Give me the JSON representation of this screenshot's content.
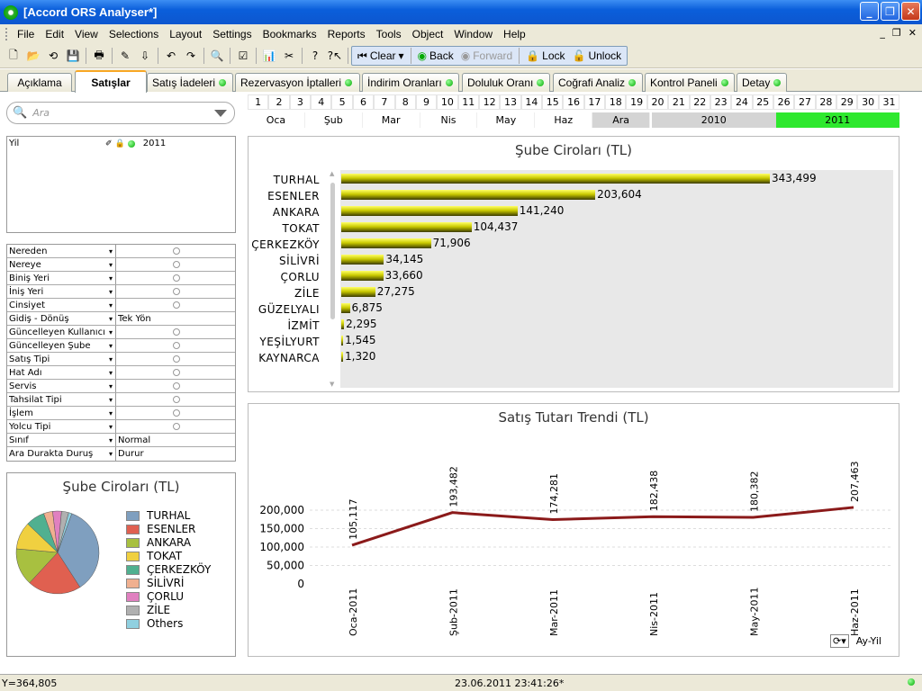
{
  "window": {
    "title": "[Accord ORS Analyser*]"
  },
  "menu": [
    "File",
    "Edit",
    "View",
    "Selections",
    "Layout",
    "Settings",
    "Bookmarks",
    "Reports",
    "Tools",
    "Object",
    "Window",
    "Help"
  ],
  "toolbar": {
    "clear": "Clear",
    "back": "Back",
    "forward": "Forward",
    "lock": "Lock",
    "unlock": "Unlock"
  },
  "tabs": [
    "Açıklama",
    "Satışlar",
    "Satış İadeleri",
    "Rezervasyon İptalleri",
    "İndirim Oranları",
    "Doluluk Oranı",
    "Coğrafi Analiz",
    "Kontrol Paneli",
    "Detay"
  ],
  "active_tab": "Satışlar",
  "search": {
    "placeholder": "Ara"
  },
  "days": [
    "1",
    "2",
    "3",
    "4",
    "5",
    "6",
    "7",
    "8",
    "9",
    "10",
    "11",
    "12",
    "13",
    "14",
    "15",
    "16",
    "17",
    "18",
    "19",
    "20",
    "21",
    "22",
    "23",
    "24",
    "25",
    "26",
    "27",
    "28",
    "29",
    "30",
    "31"
  ],
  "months": [
    "Oca",
    "Şub",
    "Mar",
    "Nis",
    "May",
    "Haz",
    "Ara"
  ],
  "years": [
    "2010",
    "2011"
  ],
  "year_list": {
    "label": "Yil",
    "value": "2011"
  },
  "filters": [
    {
      "label": "Nereden",
      "value": ""
    },
    {
      "label": "Nereye",
      "value": ""
    },
    {
      "label": "Biniş Yeri",
      "value": ""
    },
    {
      "label": "İniş Yeri",
      "value": ""
    },
    {
      "label": "Cinsiyet",
      "value": ""
    },
    {
      "label": "Gidiş - Dönüş",
      "value": "Tek Yön"
    },
    {
      "label": "Güncelleyen Kullanıcı",
      "value": ""
    },
    {
      "label": "Güncelleyen Şube",
      "value": ""
    },
    {
      "label": "Satış Tipi",
      "value": ""
    },
    {
      "label": "Hat Adı",
      "value": ""
    },
    {
      "label": "Servis",
      "value": ""
    },
    {
      "label": "Tahsilat Tipi",
      "value": ""
    },
    {
      "label": "İşlem",
      "value": ""
    },
    {
      "label": "Yolcu Tipi",
      "value": ""
    },
    {
      "label": "Sınıf",
      "value": "Normal"
    },
    {
      "label": "Ara Durakta Duruş",
      "value": "Durur"
    }
  ],
  "pie": {
    "title": "Şube Ciroları (TL)",
    "legend": [
      {
        "label": "TURHAL",
        "color": "#7f9fbf"
      },
      {
        "label": "ESENLER",
        "color": "#e06050"
      },
      {
        "label": "ANKARA",
        "color": "#a8c040"
      },
      {
        "label": "TOKAT",
        "color": "#f0d040"
      },
      {
        "label": "ÇERKEZKÖY",
        "color": "#50b090"
      },
      {
        "label": "SİLİVRİ",
        "color": "#f0b090"
      },
      {
        "label": "ÇORLU",
        "color": "#e080c0"
      },
      {
        "label": "ZİLE",
        "color": "#b0b0b0"
      },
      {
        "label": "Others",
        "color": "#90d0e0"
      }
    ]
  },
  "status": {
    "left": "Y=364,805",
    "center": "23.06.2011 23:41:26*"
  },
  "line_ctrl": {
    "label": "Ay-Yil"
  },
  "chart_data": [
    {
      "type": "bar",
      "title": "Şube Ciroları (TL)",
      "categories": [
        "TURHAL",
        "ESENLER",
        "ANKARA",
        "TOKAT",
        "ÇERKEZKÖY",
        "SİLİVRİ",
        "ÇORLU",
        "ZİLE",
        "GÜZELYALI",
        "İZMİT",
        "YEŞİLYURT",
        "KAYNARCA"
      ],
      "values": [
        343499,
        203604,
        141240,
        104437,
        71906,
        34145,
        33660,
        27275,
        6875,
        2295,
        1545,
        1320
      ],
      "labels": [
        "343,499",
        "203,604",
        "141,240",
        "104,437",
        "71,906",
        "34,145",
        "33,660",
        "27,275",
        "6,875",
        "2,295",
        "1,545",
        "1,320"
      ],
      "orientation": "horizontal"
    },
    {
      "type": "line",
      "title": "Satış Tutarı Trendi (TL)",
      "x": [
        "Oca-2011",
        "Şub-2011",
        "Mar-2011",
        "Nis-2011",
        "May-2011",
        "Haz-2011"
      ],
      "values": [
        105117,
        193482,
        174281,
        182438,
        180382,
        207463
      ],
      "labels": [
        "105,117",
        "193,482",
        "174,281",
        "182,438",
        "180,382",
        "207,463"
      ],
      "yticks": [
        "0",
        "50,000",
        "100,000",
        "150,000",
        "200,000"
      ],
      "ylim": [
        0,
        200000
      ],
      "color": "#8b1a1a"
    },
    {
      "type": "pie",
      "title": "Şube Ciroları (TL)",
      "categories": [
        "TURHAL",
        "ESENLER",
        "ANKARA",
        "TOKAT",
        "ÇERKEZKÖY",
        "SİLİVRİ",
        "ÇORLU",
        "ZİLE",
        "Others"
      ],
      "values": [
        343499,
        203604,
        141240,
        104437,
        71906,
        34145,
        33660,
        27275,
        12035
      ]
    }
  ]
}
